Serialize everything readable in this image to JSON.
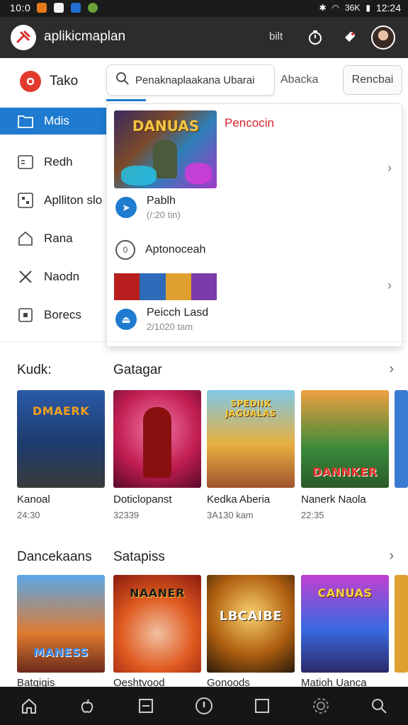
{
  "status": {
    "time": "10:0",
    "signal": "36K",
    "clock": "12:24"
  },
  "appbar": {
    "title": "aplikicmaplan",
    "bits": "bilt"
  },
  "sidebar": {
    "brand": "Tako",
    "items": [
      {
        "label": "Mdis"
      },
      {
        "label": "Redh"
      },
      {
        "label": "Aplliton slo"
      },
      {
        "label": "Rana"
      },
      {
        "label": "Naodn"
      },
      {
        "label": "Borecs"
      }
    ]
  },
  "search": {
    "value": "Penaknaplaakana Ubarai"
  },
  "tabs": {
    "abacka": "Abacka",
    "rencbai": "Rencbai"
  },
  "panel": {
    "feature_title": "Pencocin",
    "feature_art_text": "DANUAS",
    "rows": [
      {
        "name": "Pablh",
        "sub": "(/:20 tin)"
      },
      {
        "name": "Aptonoceah",
        "sub": ""
      },
      {
        "name": "Peicch Lasd",
        "sub": "2/1020 tam"
      }
    ]
  },
  "sections": [
    {
      "title_left": "Kudk:",
      "title_right": "Gatagar",
      "cards": [
        {
          "art": "DMAERK",
          "label": "Kanoal",
          "sub": "24:30"
        },
        {
          "art": "",
          "label": "Doticlopanst",
          "sub": "32339"
        },
        {
          "art": "SPEDIIK JAGUALAS",
          "label": "Kedka Aberia",
          "sub": "3A130 kam"
        },
        {
          "art": "DANNKER",
          "label": "Nanerk Naola",
          "sub": "22:35"
        }
      ]
    },
    {
      "title_left": "Dancekaans",
      "title_right": "Satapiss",
      "cards": [
        {
          "art": "MANESS",
          "label": "Batgigis",
          "sub": ""
        },
        {
          "art": "NAANER",
          "label": "Oeshtvood",
          "sub": ""
        },
        {
          "art": "LBCAIBE",
          "label": "Gonoods",
          "sub": ""
        },
        {
          "art": "CANUAS",
          "label": "Matioh Uanca",
          "sub": ""
        }
      ]
    }
  ]
}
